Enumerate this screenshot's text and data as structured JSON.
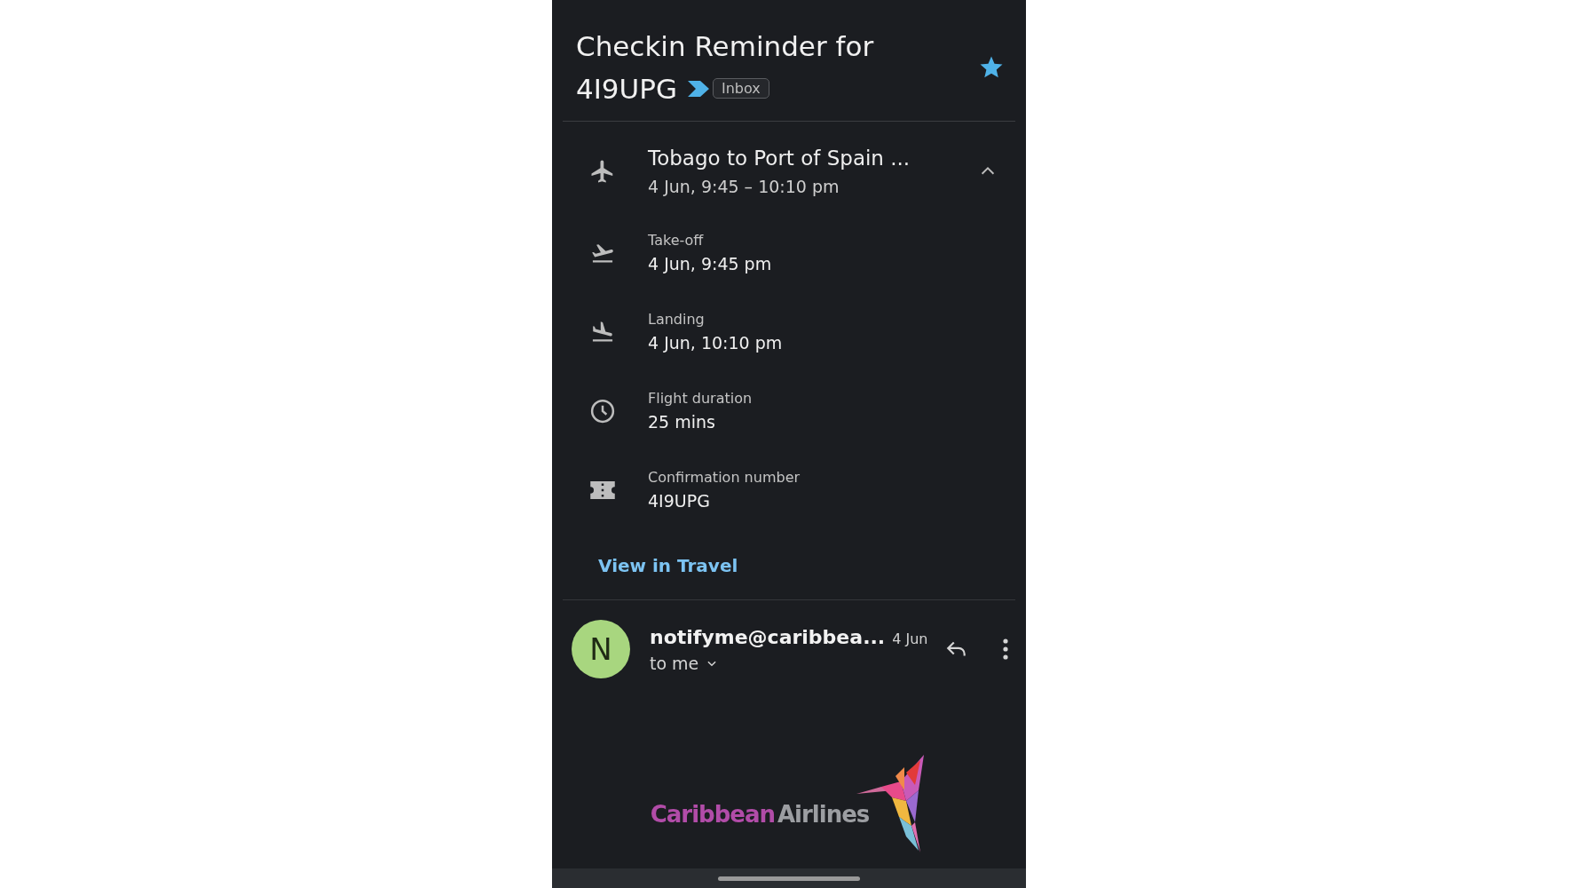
{
  "email": {
    "subject_lines": [
      "Checkin Reminder for",
      "4I9UPG"
    ],
    "label": "Inbox",
    "important": true,
    "starred": true
  },
  "flight_card": {
    "route": "Tobago to Port of Spain ...",
    "times": "4 Jun, 9:45 – 10:10 pm",
    "expanded": true,
    "details": [
      {
        "kind": "takeoff",
        "label": "Take-off",
        "value": "4 Jun, 9:45 pm"
      },
      {
        "kind": "landing",
        "label": "Landing",
        "value": "4 Jun, 10:10 pm"
      },
      {
        "kind": "duration",
        "label": "Flight duration",
        "value": "25 mins"
      },
      {
        "kind": "confirmation",
        "label": "Confirmation number",
        "value": "4I9UPG"
      }
    ],
    "link": "View in Travel"
  },
  "message": {
    "avatar": "N",
    "sender": "notifyme@caribbea...",
    "date": "4 Jun",
    "recipient": "to me"
  },
  "logo": {
    "first_word": "Caribbean",
    "second_word": "Airlines"
  }
}
